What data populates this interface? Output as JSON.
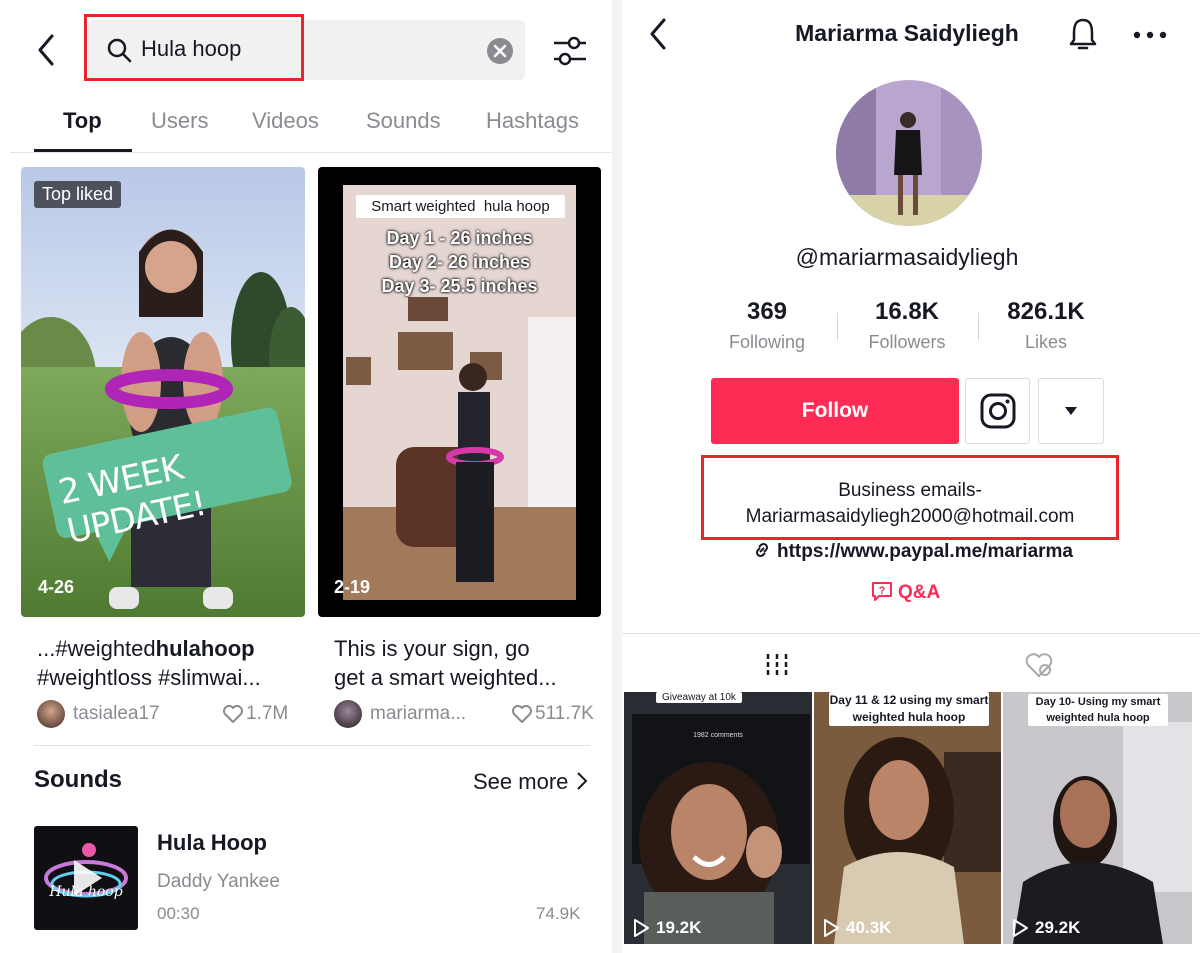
{
  "search": {
    "query": "Hula hoop",
    "tabs": [
      "Top",
      "Users",
      "Videos",
      "Sounds",
      "Hashtags"
    ],
    "active_tab": "Top"
  },
  "videos": [
    {
      "badge": "Top liked",
      "overlay_text": "2 WEEK UPDATE!",
      "date": "4-26",
      "caption_prefix": "...#weighted",
      "caption_bold": "hulahoop",
      "caption_line2": "#weightloss #slimwai...",
      "author": "tasialea17",
      "likes": "1.7M"
    },
    {
      "title_tag": "Smart weighted  hula hoop",
      "lines": [
        "Day 1 - 26 inches",
        "Day 2- 26 inches",
        "Day 3- 25.5 inches"
      ],
      "date": "2-19",
      "caption_line1": "This is your sign, go",
      "caption_line2": "get a smart weighted...",
      "author": "mariarma...",
      "likes": "511.7K"
    }
  ],
  "sounds": {
    "header": "Sounds",
    "see_more": "See more",
    "item": {
      "title": "Hula Hoop",
      "artist": "Daddy Yankee",
      "duration": "00:30",
      "uses": "74.9K",
      "cover_text": "Hula hoop"
    }
  },
  "profile": {
    "name": "Mariarma Saidyliegh",
    "handle": "@mariarmasaidyliegh",
    "stats": [
      {
        "value": "369",
        "label": "Following"
      },
      {
        "value": "16.8K",
        "label": "Followers"
      },
      {
        "value": "826.1K",
        "label": "Likes"
      }
    ],
    "follow_label": "Follow",
    "bio_line1": "Business emails-",
    "bio_line2": "Mariarmasaidyliegh2000@hotmail.com",
    "link": "https://www.paypal.me/mariarma",
    "qa": "Q&A"
  },
  "grid": [
    {
      "caption": "Giveaway at 10k",
      "views": "19.2K",
      "comments_header": "1982 comments"
    },
    {
      "caption_line1": "Day 11 & 12 using my smart",
      "caption_line2": "weighted hula hoop",
      "views": "40.3K"
    },
    {
      "caption_line1": "Day 10- Using my smart",
      "caption_line2": "weighted hula hoop",
      "views": "29.2K"
    }
  ],
  "colors": {
    "accent": "#fe2c55",
    "highlight_box": "#e8242c",
    "tab_underline": "#161823",
    "muted": "#8a8b91"
  }
}
